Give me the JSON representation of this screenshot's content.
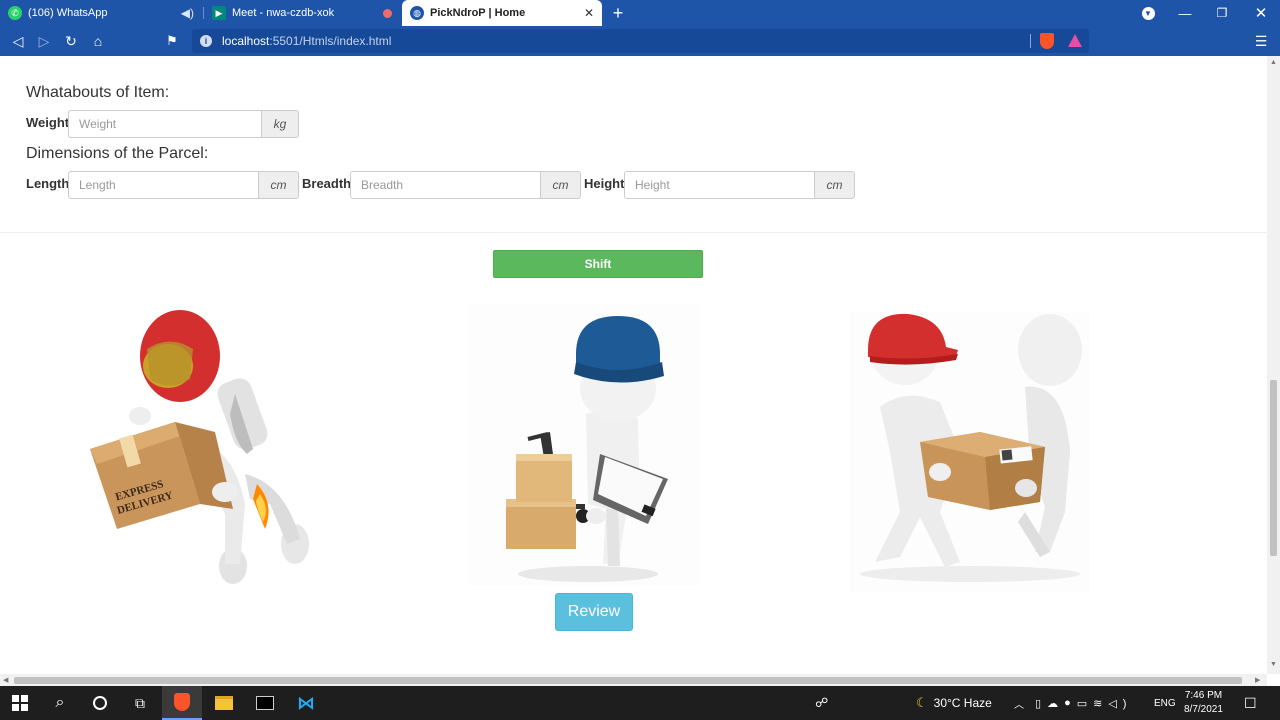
{
  "browser": {
    "tabs": [
      {
        "title": "(106) WhatsApp",
        "icon": "whatsapp-icon",
        "icon_color": "#25d366",
        "status": "speaker-icon"
      },
      {
        "title": "Meet - nwa-czdb-xok",
        "icon": "google-meet-icon",
        "icon_color": "#00897b",
        "status": "recording-icon"
      },
      {
        "title": "PickNdroP | Home",
        "icon": "globe-icon",
        "active": true
      }
    ],
    "address": {
      "host": "localhost",
      "path": ":5501/Htmls/index.html"
    }
  },
  "form": {
    "item_heading": "Whatabouts of Item:",
    "weight": {
      "label": "Weight",
      "placeholder": "Weight",
      "unit": "kg"
    },
    "parcel_heading": "Dimensions of the Parcel:",
    "length": {
      "label": "Length",
      "placeholder": "Length",
      "unit": "cm"
    },
    "breadth": {
      "label": "Breadth",
      "placeholder": "Breadth",
      "unit": "cm"
    },
    "height": {
      "label": "Height",
      "placeholder": "Height",
      "unit": "cm"
    }
  },
  "actions": {
    "shift_label": "Shift",
    "review_label": "Review"
  },
  "colors": {
    "browser_chrome": "#1f55a8",
    "shift_button": "#5cb85c",
    "review_button": "#5bc0de"
  },
  "taskbar": {
    "weather": "30°C  Haze",
    "language": "ENG",
    "time": "7:46 PM",
    "date": "8/7/2021"
  }
}
